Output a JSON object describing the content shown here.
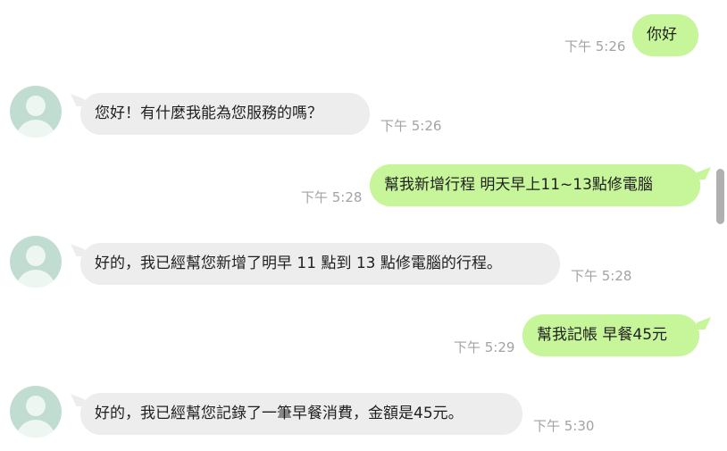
{
  "messages": [
    {
      "sender": "user",
      "text": "你好",
      "time": "下午 5:26"
    },
    {
      "sender": "bot",
      "text": "您好！有什麼我能為您服務的嗎？",
      "time": "下午 5:26"
    },
    {
      "sender": "user",
      "text": "幫我新增行程 明天早上11~13點修電腦",
      "time": "下午 5:28"
    },
    {
      "sender": "bot",
      "text": "好的，我已經幫您新增了明早 11 點到 13 點修電腦的行程。",
      "time": "下午 5:28"
    },
    {
      "sender": "user",
      "text": "幫我記帳 早餐45元",
      "time": "下午 5:29"
    },
    {
      "sender": "bot",
      "text": "好的，我已經幫您記錄了一筆早餐消費，金額是45元。",
      "time": "下午 5:30"
    }
  ],
  "colors": {
    "user_bubble": "#c6f59a",
    "bot_bubble": "#ededed",
    "avatar_bg": "#c1ddd2",
    "timestamp": "#a3a3a3"
  },
  "icons": {
    "avatar": "default-user-avatar-icon"
  }
}
